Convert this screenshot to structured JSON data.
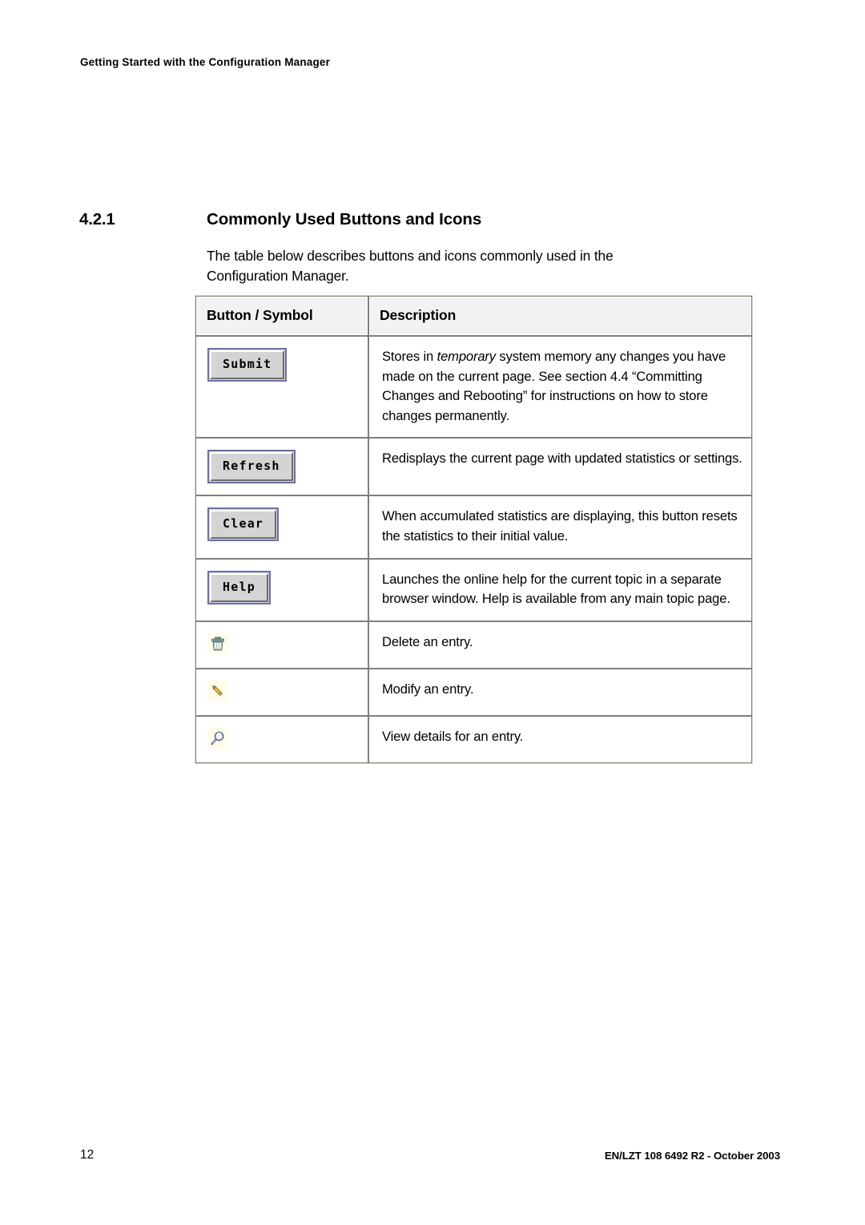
{
  "header": {
    "running_title": "Getting Started with the Configuration Manager"
  },
  "section": {
    "number": "4.2.1",
    "title": "Commonly Used Buttons and Icons",
    "intro": "The table below describes buttons and icons commonly used in the Configuration Manager."
  },
  "table": {
    "columns": [
      {
        "label": "Button / Symbol"
      },
      {
        "label": "Description"
      }
    ],
    "rows": [
      {
        "symbol_type": "button",
        "symbol_name": "submit-button",
        "symbol_label": "Submit",
        "description_parts": [
          {
            "text": "Stores in ",
            "style": "normal"
          },
          {
            "text": "temporary",
            "style": "italic"
          },
          {
            "text": " system memory any changes you have made on the current page. See section 4.4 “Committing Changes and Rebooting” for instructions on how to store changes permanently.",
            "style": "normal"
          }
        ]
      },
      {
        "symbol_type": "button",
        "symbol_name": "refresh-button",
        "symbol_label": "Refresh",
        "description_parts": [
          {
            "text": "Redisplays the current page with updated statistics or settings.",
            "style": "normal"
          }
        ]
      },
      {
        "symbol_type": "button",
        "symbol_name": "clear-button",
        "symbol_label": "Clear",
        "description_parts": [
          {
            "text": "When accumulated statistics are displaying, this button resets the statistics to their initial value.",
            "style": "normal"
          }
        ]
      },
      {
        "symbol_type": "button",
        "symbol_name": "help-button",
        "symbol_label": "Help",
        "description_parts": [
          {
            "text": "Launches the online help for the current topic in a separate browser window. Help is available from any main topic page.",
            "style": "normal"
          }
        ]
      },
      {
        "symbol_type": "icon",
        "symbol_name": "trash-icon",
        "symbol_label": "",
        "description_parts": [
          {
            "text": "Delete an entry.",
            "style": "normal"
          }
        ]
      },
      {
        "symbol_type": "icon",
        "symbol_name": "pencil-icon",
        "symbol_label": "",
        "description_parts": [
          {
            "text": "Modify an entry.",
            "style": "normal"
          }
        ]
      },
      {
        "symbol_type": "icon",
        "symbol_name": "magnifier-icon",
        "symbol_label": "",
        "description_parts": [
          {
            "text": "View details for an entry.",
            "style": "normal"
          }
        ]
      }
    ]
  },
  "footer": {
    "page_number": "12",
    "document_reference": "EN/LZT 108 6492 R2  - October 2003"
  },
  "colors": {
    "button_border": "#6c6fa8",
    "button_face": "#d4d4d4",
    "icon_background": "#fffdea",
    "table_border": "#7f7f7f",
    "table_header_fill": "#f2f2f0",
    "trash_icon": "#6f8b84",
    "pencil_icon": "#f2c33c",
    "magnifier_icon": "#8b8fb5"
  }
}
